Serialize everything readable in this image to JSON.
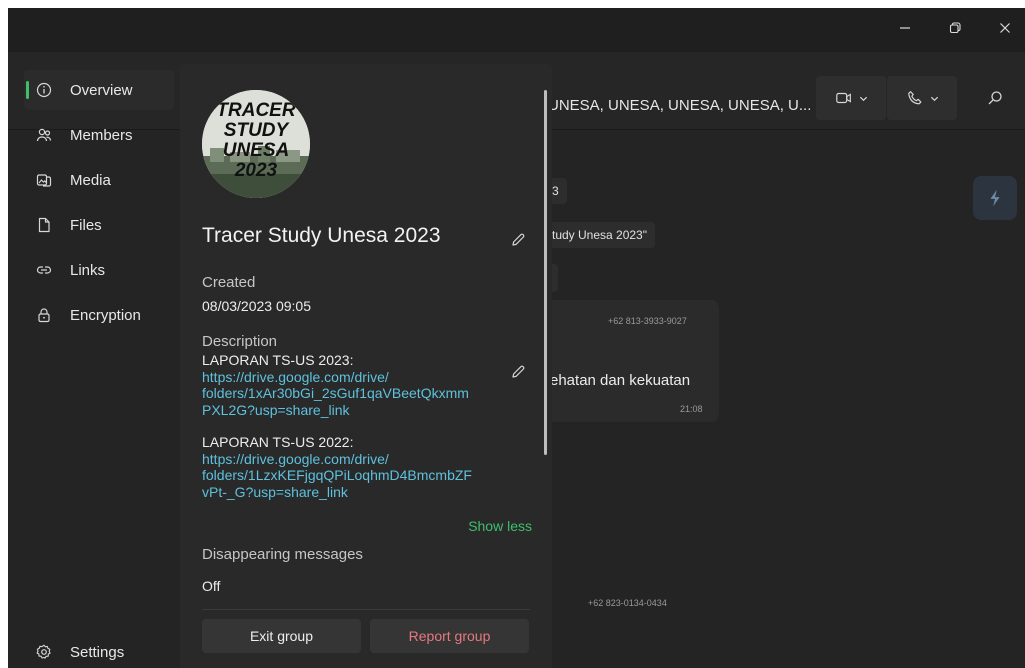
{
  "window_controls": {
    "minimize": "minimize-icon",
    "restore": "restore-icon",
    "close": "close-icon"
  },
  "chat": {
    "title": "UNESA, UNESA, UNESA, UNESA, U...",
    "chip_1": "3",
    "chip_2": "tudy Unesa 2023\"",
    "msg_sender": "+62 813-3933-9027",
    "msg_text": "ehatan dan kekuatan",
    "msg_time": "21:08",
    "sender_2": "+62 823-0134-0434"
  },
  "nav": {
    "items": [
      {
        "label": "Overview",
        "icon": "info-icon"
      },
      {
        "label": "Members",
        "icon": "members-icon"
      },
      {
        "label": "Media",
        "icon": "media-icon"
      },
      {
        "label": "Files",
        "icon": "file-icon"
      },
      {
        "label": "Links",
        "icon": "link-icon"
      },
      {
        "label": "Encryption",
        "icon": "lock-icon"
      }
    ],
    "settings_label": "Settings",
    "active_color": "#3fbf6b"
  },
  "panel": {
    "avatar_text": [
      "TRACER",
      "STUDY",
      "UNESA",
      "2023"
    ],
    "group_name": "Tracer Study Unesa 2023",
    "created_label": "Created",
    "created_value": "08/03/2023 09:05",
    "description_label": "Description",
    "description": {
      "line1": "LAPORAN TS-US 2023:",
      "link1": [
        "https://drive.google.com/drive/",
        "folders/1xAr30bGi_2sGuf1qaVBeetQkxmm",
        "PXL2G?usp=share_link"
      ],
      "line2": "LAPORAN TS-US 2022:",
      "link2": [
        "https://drive.google.com/drive/",
        "folders/1LzxKEFjgqQPiLoqhmD4BmcmbZF",
        "vPt-_G?usp=share_link"
      ]
    },
    "show_less": "Show less",
    "disappearing_label": "Disappearing messages",
    "disappearing_value": "Off",
    "exit_button": "Exit group",
    "report_button": "Report group",
    "link_color": "#5ec1dd",
    "danger_color": "#e5797f"
  }
}
